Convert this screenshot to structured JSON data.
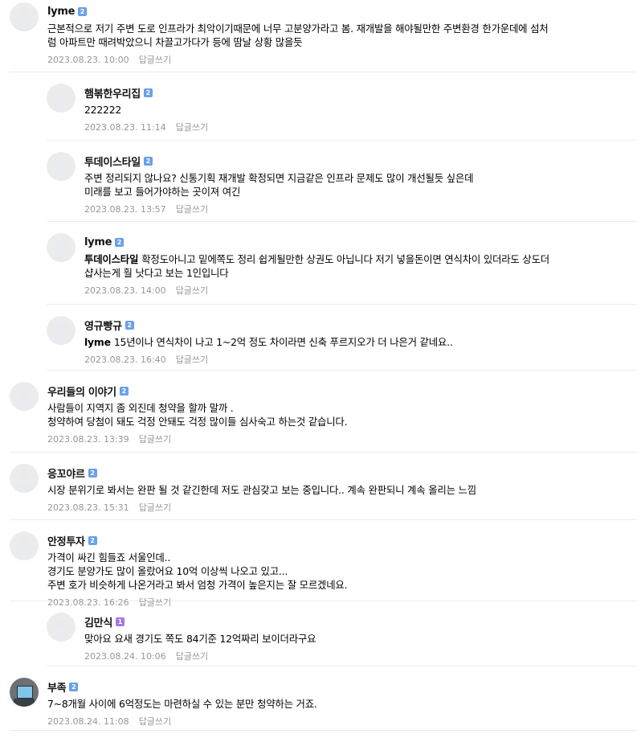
{
  "reply_label": "답글쓰기",
  "comments": [
    {
      "level": 0,
      "avatar": "default",
      "nick": "lyme",
      "badge": "2",
      "badge_color": "#6aa0e6",
      "mention": "",
      "lines": [
        "근본적으로 저기 주변 도로 인프라가 최악이기때문에 너무 고분양가라고 봄. 재개발을 해야될만한 주변환경 한가운데에 섬처",
        "럼 아파트만 때려박았으니 차끌고가다가 등에 땀날 상황 많을듯"
      ],
      "date": "2023.08.23. 10:00"
    },
    {
      "level": 1,
      "avatar": "default",
      "nick": "햄볶한우리집",
      "badge": "2",
      "badge_color": "#6aa0e6",
      "mention": "",
      "lines": [
        "222222"
      ],
      "date": "2023.08.23. 11:14"
    },
    {
      "level": 1,
      "avatar": "default",
      "nick": "투데이스타일",
      "badge": "2",
      "badge_color": "#6aa0e6",
      "mention": "",
      "lines": [
        "주변 정리되지 않나요? 신통기획 재개발 확정되면 지금같은 인프라 문제도 많이 개선될듯 싶은데",
        "미래를 보고 들어가야하는 곳이져 여긴"
      ],
      "date": "2023.08.23. 13:57"
    },
    {
      "level": 1,
      "avatar": "default",
      "nick": "lyme",
      "badge": "2",
      "badge_color": "#6aa0e6",
      "mention": "투데이스타일",
      "lines": [
        "확정도아니고 밑에쪽도 정리 쉽게될만한 상권도 아닙니다 저기 넣을돈이면 연식차이 있더라도 상도더",
        "샵사는게 훨 낫다고 보는 1인입니다"
      ],
      "date": "2023.08.23. 14:00"
    },
    {
      "level": 1,
      "avatar": "default",
      "nick": "영규빵규",
      "badge": "2",
      "badge_color": "#6aa0e6",
      "mention": "lyme",
      "lines": [
        "15년이나 연식차이 나고 1~2억 정도 차이라면 신축 푸르지오가 더 나은거 같네요.."
      ],
      "date": "2023.08.23. 16:40"
    },
    {
      "level": 0,
      "avatar": "default",
      "nick": "우리들의 이야기",
      "badge": "2",
      "badge_color": "#6aa0e6",
      "mention": "",
      "lines": [
        "사람들이 지역지 좀 외진데 청약을 할까 말까 .",
        "청약하여 당첨이 돼도 걱정 안돼도 걱정 많이들 심사숙고 하는것 같습니다."
      ],
      "date": "2023.08.23. 13:39"
    },
    {
      "level": 0,
      "avatar": "default",
      "nick": "응꼬야르",
      "badge": "2",
      "badge_color": "#6aa0e6",
      "mention": "",
      "lines": [
        "시장 분위기로 봐서는 완판 될 것 같긴한데 저도 관심갖고 보는 중입니다.. 계속 완판되니 계속 올리는 느낌"
      ],
      "date": "2023.08.23. 15:31"
    },
    {
      "level": 0,
      "avatar": "default",
      "nick": "안정투자",
      "badge": "2",
      "badge_color": "#6aa0e6",
      "mention": "",
      "lines": [
        "가격이 싸긴 힘들죠 서울인데..",
        "경기도 분양가도 많이 올랐어요 10억 이상씩 나오고 있고...",
        "주변 호가 비슷하게 나온거라고 봐서 엄청 가격이 높은지는 잘 모르겠네요."
      ],
      "date": "2023.08.23. 16:26"
    },
    {
      "level": 1,
      "avatar": "default",
      "nick": "김만식",
      "badge": "1",
      "badge_color": "#a57ae0",
      "mention": "",
      "lines": [
        "맞아요 요새 경기도 쪽도 84기준 12억짜리 보이더라구요"
      ],
      "date": "2023.08.24. 10:06"
    },
    {
      "level": 0,
      "avatar": "photo",
      "nick": "부족",
      "badge": "2",
      "badge_color": "#6aa0e6",
      "mention": "",
      "lines": [
        "7~8개월 사이에 6억정도는 마련하실 수 있는 분만 청약하는 거죠."
      ],
      "date": "2023.08.24. 11:08"
    }
  ]
}
